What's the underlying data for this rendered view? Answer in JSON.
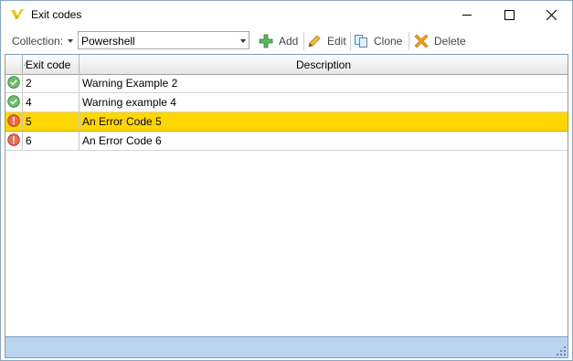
{
  "window": {
    "title": "Exit codes",
    "icons": {
      "app": "app-logo-icon",
      "minimize": "minimize-icon",
      "maximize": "maximize-icon",
      "close": "close-icon"
    }
  },
  "toolbar": {
    "collection_label": "Collection:",
    "collection_value": "Powershell",
    "add_label": "Add",
    "edit_label": "Edit",
    "clone_label": "Clone",
    "delete_label": "Delete"
  },
  "grid": {
    "columns": {
      "exit_code": "Exit code",
      "description": "Description"
    },
    "sorted_column": "exit_code",
    "rows": [
      {
        "status": "success-icon",
        "code": "2",
        "description": "Warning Example 2",
        "selected": false
      },
      {
        "status": "success-icon",
        "code": "4",
        "description": "Warning example 4",
        "selected": false
      },
      {
        "status": "error-icon",
        "code": "5",
        "description": "An Error Code 5",
        "selected": true
      },
      {
        "status": "error-icon",
        "code": "6",
        "description": "An Error Code 6",
        "selected": false
      }
    ]
  },
  "colors": {
    "selected_row": "#ffd700",
    "statusbar": "#bad3ef",
    "success": "#4caf50",
    "error": "#e8573f"
  }
}
